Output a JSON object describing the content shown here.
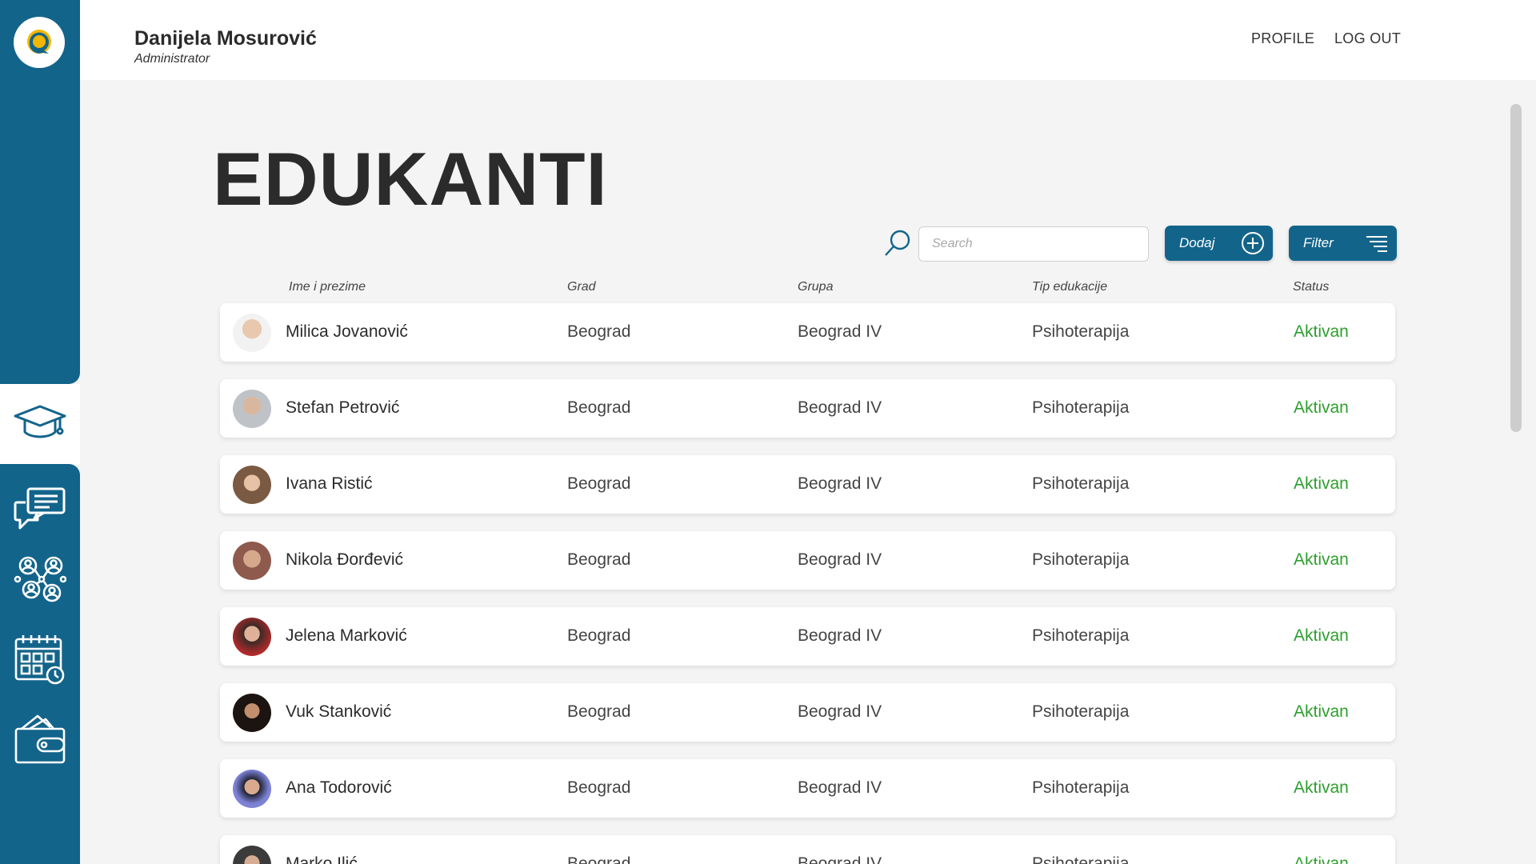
{
  "header": {
    "user_name": "Danijela Mosurović",
    "user_role": "Administrator",
    "nav": {
      "profile": "PROFILE",
      "logout": "LOG OUT"
    }
  },
  "sidebar": {
    "logo": "chat-bubble-logo",
    "items": [
      {
        "icon": "graduation-cap-icon",
        "active": true
      },
      {
        "icon": "chat-bubbles-icon",
        "active": false
      },
      {
        "icon": "people-network-icon",
        "active": false
      },
      {
        "icon": "calendar-clock-icon",
        "active": false
      },
      {
        "icon": "wallet-icon",
        "active": false
      }
    ]
  },
  "page": {
    "title": "EDUKANTI",
    "search_placeholder": "Search",
    "add_label": "Dodaj",
    "filter_label": "Filter"
  },
  "table": {
    "columns": [
      "Ime i prezime",
      "Grad",
      "Grupa",
      "Tip edukacije",
      "Status"
    ],
    "rows": [
      {
        "name": "Milica Jovanović",
        "grad": "Beograd",
        "grupa": "Beograd IV",
        "tip": "Psihoterapija",
        "status": "Aktivan"
      },
      {
        "name": "Stefan Petrović",
        "grad": "Beograd",
        "grupa": "Beograd IV",
        "tip": "Psihoterapija",
        "status": "Aktivan"
      },
      {
        "name": "Ivana Ristić",
        "grad": "Beograd",
        "grupa": "Beograd IV",
        "tip": "Psihoterapija",
        "status": "Aktivan"
      },
      {
        "name": "Nikola Đorđević",
        "grad": "Beograd",
        "grupa": "Beograd IV",
        "tip": "Psihoterapija",
        "status": "Aktivan"
      },
      {
        "name": "Jelena Marković",
        "grad": "Beograd",
        "grupa": "Beograd IV",
        "tip": "Psihoterapija",
        "status": "Aktivan"
      },
      {
        "name": "Vuk Stanković",
        "grad": "Beograd",
        "grupa": "Beograd IV",
        "tip": "Psihoterapija",
        "status": "Aktivan"
      },
      {
        "name": "Ana Todorović",
        "grad": "Beograd",
        "grupa": "Beograd IV",
        "tip": "Psihoterapija",
        "status": "Aktivan"
      },
      {
        "name": "Marko Ilić",
        "grad": "Beograd",
        "grupa": "Beograd IV",
        "tip": "Psihoterapija",
        "status": "Aktivan"
      }
    ]
  },
  "colors": {
    "primary": "#13648a",
    "status_active": "#2e9f2e",
    "background": "#f4f4f4"
  }
}
